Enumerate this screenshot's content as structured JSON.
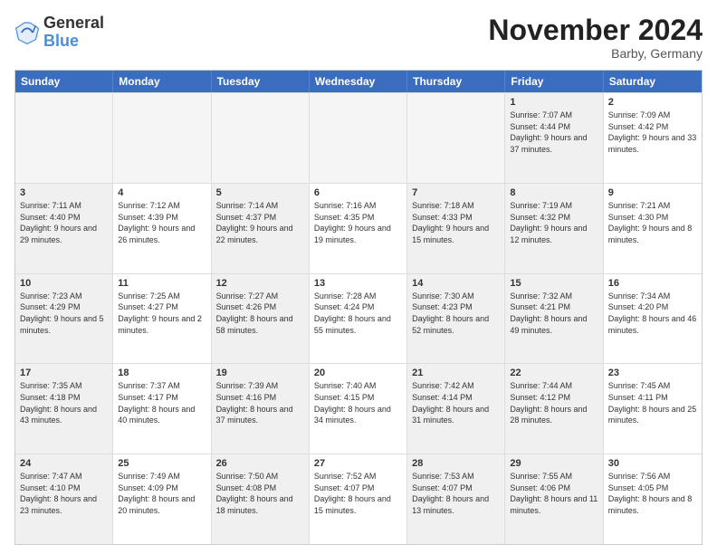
{
  "header": {
    "logo_general": "General",
    "logo_blue": "Blue",
    "month_title": "November 2024",
    "location": "Barby, Germany"
  },
  "weekdays": [
    "Sunday",
    "Monday",
    "Tuesday",
    "Wednesday",
    "Thursday",
    "Friday",
    "Saturday"
  ],
  "rows": [
    [
      {
        "day": "",
        "text": "",
        "empty": true
      },
      {
        "day": "",
        "text": "",
        "empty": true
      },
      {
        "day": "",
        "text": "",
        "empty": true
      },
      {
        "day": "",
        "text": "",
        "empty": true
      },
      {
        "day": "",
        "text": "",
        "empty": true
      },
      {
        "day": "1",
        "text": "Sunrise: 7:07 AM\nSunset: 4:44 PM\nDaylight: 9 hours and 37 minutes.",
        "shaded": true
      },
      {
        "day": "2",
        "text": "Sunrise: 7:09 AM\nSunset: 4:42 PM\nDaylight: 9 hours and 33 minutes.",
        "shaded": false
      }
    ],
    [
      {
        "day": "3",
        "text": "Sunrise: 7:11 AM\nSunset: 4:40 PM\nDaylight: 9 hours and 29 minutes.",
        "shaded": true
      },
      {
        "day": "4",
        "text": "Sunrise: 7:12 AM\nSunset: 4:39 PM\nDaylight: 9 hours and 26 minutes.",
        "shaded": false
      },
      {
        "day": "5",
        "text": "Sunrise: 7:14 AM\nSunset: 4:37 PM\nDaylight: 9 hours and 22 minutes.",
        "shaded": true
      },
      {
        "day": "6",
        "text": "Sunrise: 7:16 AM\nSunset: 4:35 PM\nDaylight: 9 hours and 19 minutes.",
        "shaded": false
      },
      {
        "day": "7",
        "text": "Sunrise: 7:18 AM\nSunset: 4:33 PM\nDaylight: 9 hours and 15 minutes.",
        "shaded": true
      },
      {
        "day": "8",
        "text": "Sunrise: 7:19 AM\nSunset: 4:32 PM\nDaylight: 9 hours and 12 minutes.",
        "shaded": true
      },
      {
        "day": "9",
        "text": "Sunrise: 7:21 AM\nSunset: 4:30 PM\nDaylight: 9 hours and 8 minutes.",
        "shaded": false
      }
    ],
    [
      {
        "day": "10",
        "text": "Sunrise: 7:23 AM\nSunset: 4:29 PM\nDaylight: 9 hours and 5 minutes.",
        "shaded": true
      },
      {
        "day": "11",
        "text": "Sunrise: 7:25 AM\nSunset: 4:27 PM\nDaylight: 9 hours and 2 minutes.",
        "shaded": false
      },
      {
        "day": "12",
        "text": "Sunrise: 7:27 AM\nSunset: 4:26 PM\nDaylight: 8 hours and 58 minutes.",
        "shaded": true
      },
      {
        "day": "13",
        "text": "Sunrise: 7:28 AM\nSunset: 4:24 PM\nDaylight: 8 hours and 55 minutes.",
        "shaded": false
      },
      {
        "day": "14",
        "text": "Sunrise: 7:30 AM\nSunset: 4:23 PM\nDaylight: 8 hours and 52 minutes.",
        "shaded": true
      },
      {
        "day": "15",
        "text": "Sunrise: 7:32 AM\nSunset: 4:21 PM\nDaylight: 8 hours and 49 minutes.",
        "shaded": true
      },
      {
        "day": "16",
        "text": "Sunrise: 7:34 AM\nSunset: 4:20 PM\nDaylight: 8 hours and 46 minutes.",
        "shaded": false
      }
    ],
    [
      {
        "day": "17",
        "text": "Sunrise: 7:35 AM\nSunset: 4:18 PM\nDaylight: 8 hours and 43 minutes.",
        "shaded": true
      },
      {
        "day": "18",
        "text": "Sunrise: 7:37 AM\nSunset: 4:17 PM\nDaylight: 8 hours and 40 minutes.",
        "shaded": false
      },
      {
        "day": "19",
        "text": "Sunrise: 7:39 AM\nSunset: 4:16 PM\nDaylight: 8 hours and 37 minutes.",
        "shaded": true
      },
      {
        "day": "20",
        "text": "Sunrise: 7:40 AM\nSunset: 4:15 PM\nDaylight: 8 hours and 34 minutes.",
        "shaded": false
      },
      {
        "day": "21",
        "text": "Sunrise: 7:42 AM\nSunset: 4:14 PM\nDaylight: 8 hours and 31 minutes.",
        "shaded": true
      },
      {
        "day": "22",
        "text": "Sunrise: 7:44 AM\nSunset: 4:12 PM\nDaylight: 8 hours and 28 minutes.",
        "shaded": true
      },
      {
        "day": "23",
        "text": "Sunrise: 7:45 AM\nSunset: 4:11 PM\nDaylight: 8 hours and 25 minutes.",
        "shaded": false
      }
    ],
    [
      {
        "day": "24",
        "text": "Sunrise: 7:47 AM\nSunset: 4:10 PM\nDaylight: 8 hours and 23 minutes.",
        "shaded": true
      },
      {
        "day": "25",
        "text": "Sunrise: 7:49 AM\nSunset: 4:09 PM\nDaylight: 8 hours and 20 minutes.",
        "shaded": false
      },
      {
        "day": "26",
        "text": "Sunrise: 7:50 AM\nSunset: 4:08 PM\nDaylight: 8 hours and 18 minutes.",
        "shaded": true
      },
      {
        "day": "27",
        "text": "Sunrise: 7:52 AM\nSunset: 4:07 PM\nDaylight: 8 hours and 15 minutes.",
        "shaded": false
      },
      {
        "day": "28",
        "text": "Sunrise: 7:53 AM\nSunset: 4:07 PM\nDaylight: 8 hours and 13 minutes.",
        "shaded": true
      },
      {
        "day": "29",
        "text": "Sunrise: 7:55 AM\nSunset: 4:06 PM\nDaylight: 8 hours and 11 minutes.",
        "shaded": true
      },
      {
        "day": "30",
        "text": "Sunrise: 7:56 AM\nSunset: 4:05 PM\nDaylight: 8 hours and 8 minutes.",
        "shaded": false
      }
    ]
  ]
}
